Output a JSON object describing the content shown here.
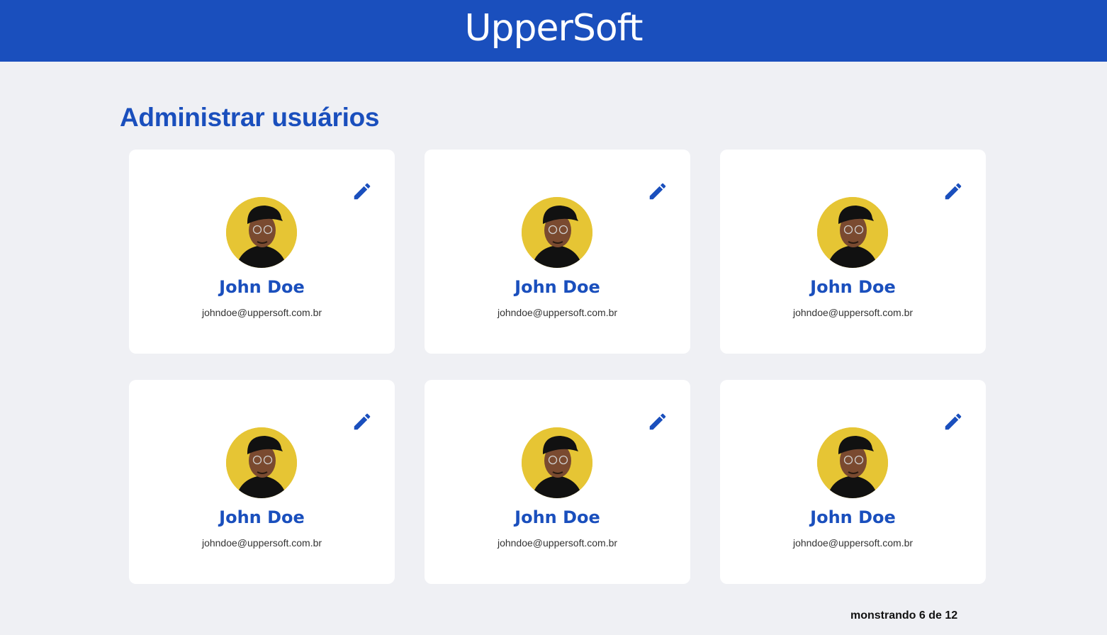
{
  "header": {
    "logo_text": "UpperSoft",
    "background_color": "#1a4fbd"
  },
  "page": {
    "title": "Administrar usuários"
  },
  "users": [
    {
      "name": "John Doe",
      "email": "johndoe@uppersoft.com.br",
      "edit_icon": "pencil-icon"
    },
    {
      "name": "John Doe",
      "email": "johndoe@uppersoft.com.br",
      "edit_icon": "pencil-icon"
    },
    {
      "name": "John Doe",
      "email": "johndoe@uppersoft.com.br",
      "edit_icon": "pencil-icon"
    },
    {
      "name": "John Doe",
      "email": "johndoe@uppersoft.com.br",
      "edit_icon": "pencil-icon"
    },
    {
      "name": "John Doe",
      "email": "johndoe@uppersoft.com.br",
      "edit_icon": "pencil-icon"
    },
    {
      "name": "John Doe",
      "email": "johndoe@uppersoft.com.br",
      "edit_icon": "pencil-icon"
    }
  ],
  "pagination": {
    "text": "monstrando 6 de 12"
  },
  "colors": {
    "accent": "#1a4fbd",
    "background": "#eff0f4",
    "card": "#ffffff",
    "avatar_bg": "#e6c534"
  }
}
